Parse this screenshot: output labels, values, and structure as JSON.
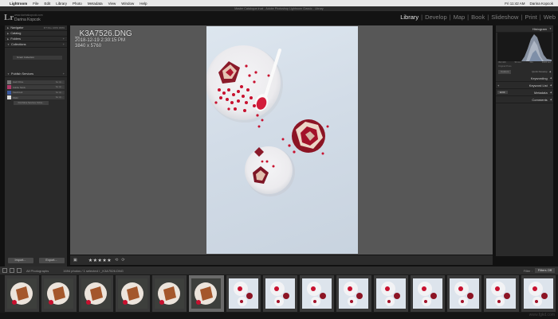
{
  "menubar": {
    "apple_symbol": "",
    "app_name": "Lightroom",
    "items": [
      "File",
      "Edit",
      "Library",
      "Photo",
      "Metadata",
      "View",
      "Window",
      "Help"
    ],
    "clock": "Fri 11:42 AM",
    "user": "Darina Kopcok"
  },
  "window_title": "Master Catalogue.lrcat - Adobe Photoshop Lightroom Classic - Library",
  "identity": {
    "logo": "Lr",
    "catalog_name": "www.darinakopcok.com",
    "user_name": "Darina Kopcok"
  },
  "modules": {
    "library": "Library",
    "develop": "Develop",
    "map": "Map",
    "book": "Book",
    "slideshow": "Slideshow",
    "print": "Print",
    "web": "Web",
    "sep": "|"
  },
  "left_panel": {
    "navigator": "Navigator",
    "nav_tools": "FIT  FILL  100%  300%",
    "catalog": "Catalog",
    "folders": "Folders",
    "collections": "Collections",
    "smart_collection": "Smart Collection",
    "publish_services": "Publish Services",
    "services": [
      {
        "label": "Hard Drive",
        "setup": "Set Up..."
      },
      {
        "label": "Adobe Stock",
        "setup": "Set Up..."
      },
      {
        "label": "Facebook",
        "setup": "Set Up..."
      },
      {
        "label": "Flickr",
        "setup": "Set Up..."
      }
    ],
    "find_more": "Find More Services Online...",
    "import_label": "Import...",
    "export_label": "Export..."
  },
  "main": {
    "filename": "_K3A7526.DNG",
    "datetime": "2018-12-19 2:30:15 PM",
    "dimensions": "3840 x 5760"
  },
  "toolbar": {
    "stars": "★★★★★"
  },
  "right_panel": {
    "histogram": "Histogram",
    "hist_info": [
      "ISO 100",
      "50 mm",
      "f/11",
      "1/200 sec"
    ],
    "original_photo": "Original Photo",
    "quick_develop": "Quick Develop",
    "custom_label": "Custom",
    "keywording": "Keywording",
    "keyword_list": "Keyword List",
    "metadata": "Metadata",
    "metadata_preset": "EXIF",
    "comments": "Comments"
  },
  "filmstrip_bar": {
    "source": "All Photographs",
    "count": "1694 photos / 1 selected / _K3A7526.DNG",
    "filter_label": "Filter :",
    "filter_value": "Filters Off"
  },
  "filmstrip": {
    "thumbs": [
      "dark",
      "dark",
      "dark",
      "dark",
      "dark",
      "dark",
      "light",
      "light",
      "light",
      "light",
      "light",
      "light",
      "light",
      "light",
      "light"
    ],
    "selected_index": 5
  },
  "watermark": "www.fgkd.com"
}
